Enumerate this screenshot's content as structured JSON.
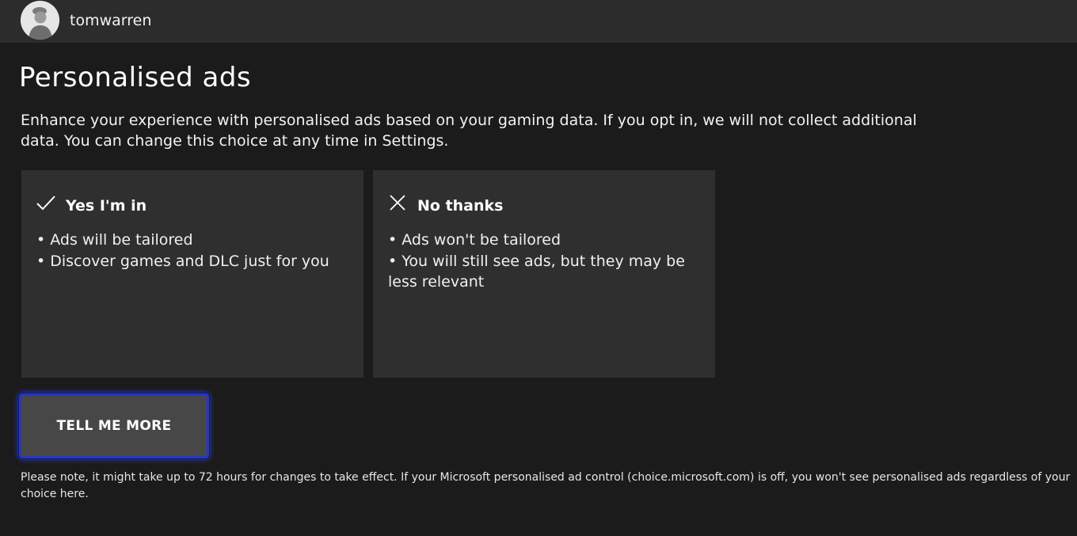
{
  "header": {
    "username": "tomwarren"
  },
  "page": {
    "title": "Personalised ads",
    "description": "Enhance your experience with personalised ads based on your gaming data. If you opt in, we will not collect additional data. You can change this choice at any time in Settings."
  },
  "choices": [
    {
      "icon": "checkmark-icon",
      "heading": "Yes I'm in",
      "points": [
        "Ads will be tailored",
        "Discover games and DLC just for you"
      ]
    },
    {
      "icon": "close-icon",
      "heading": "No thanks",
      "points": [
        "Ads won't be tailored",
        "You will still see ads, but they may be less relevant"
      ]
    }
  ],
  "actions": {
    "tell_me_more_label": "TELL ME MORE"
  },
  "footnote": "Please note, it might take up to 72 hours for changes to take effect. If your Microsoft personalised ad control (choice.microsoft.com) is off, you won't see personalised ads regardless of your choice here.",
  "colors": {
    "background": "#1b1b1b",
    "topbar": "#2c2c2c",
    "card": "#2f2f2f",
    "button": "#474747",
    "focus_ring": "#2636c8"
  }
}
